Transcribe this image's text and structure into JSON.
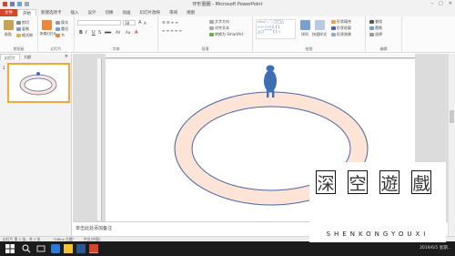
{
  "title_bar": {
    "title": "环形圈圈 - Microsoft PowerPoint",
    "controls": [
      "–",
      "□",
      "✕"
    ]
  },
  "tabs": [
    "文件",
    "开始",
    "新建选项卡",
    "插入",
    "设计",
    "切换",
    "动画",
    "幻灯片放映",
    "审阅",
    "视图"
  ],
  "ribbon": {
    "clipboard": {
      "paste": "粘贴",
      "cut": "剪切",
      "copy": "复制",
      "format_painter": "格式刷",
      "label": "剪贴板"
    },
    "slides": {
      "new_slide": "新建幻灯片",
      "layout": "版式",
      "reset": "重设",
      "section": "节",
      "label": "幻灯片"
    },
    "font": {
      "size": "18",
      "label": "字体",
      "bold": "B",
      "italic": "I",
      "underline": "U",
      "shadow": "S",
      "strike": "abc",
      "spacing": "AV",
      "case": "Aa",
      "color": "A"
    },
    "paragraph": {
      "text_direction": "文字方向",
      "align_text": "对齐文本",
      "smartart": "转换为 SmartArt",
      "label": "段落"
    },
    "drawing": {
      "arrange": "排列",
      "quick_styles": "快速样式",
      "shape_fill": "形状填充",
      "shape_outline": "形状轮廓",
      "shape_effects": "形状效果",
      "label": "绘图"
    },
    "editing": {
      "find": "查找",
      "replace": "替换",
      "select": "选择",
      "label": "编辑"
    }
  },
  "left_pane": {
    "tabs": [
      "幻灯片",
      "大纲"
    ],
    "close": "×",
    "slide_number": "1"
  },
  "notes": {
    "placeholder": "单击此处添加备注"
  },
  "status_bar": {
    "slide_info": "幻灯片 第 1 张，共 1 张",
    "theme": "\"Office 主题\"",
    "language": "中文(中国)"
  },
  "taskbar": {
    "time": "2019/6/5 星期..."
  },
  "watermark": {
    "chars": [
      "深",
      "空",
      "遊",
      "戲"
    ],
    "latin": "SHENKONGYOUXI"
  },
  "colors": {
    "accent": "#d24726",
    "ring_fill": "#fde4d6",
    "ring_stroke": "#4a66a4",
    "figure": "#3e6fb5",
    "thumb_border": "#f3a63a"
  }
}
